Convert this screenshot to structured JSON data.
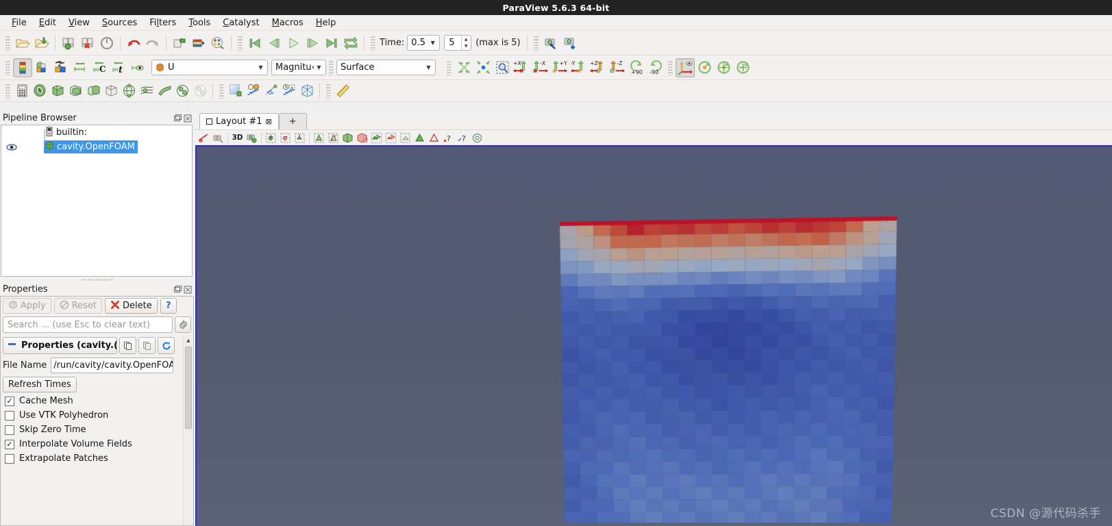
{
  "window": {
    "title": "ParaView 5.6.3 64-bit"
  },
  "menubar": {
    "items": [
      {
        "label": "File",
        "mnemonic": "F"
      },
      {
        "label": "Edit",
        "mnemonic": "E"
      },
      {
        "label": "View",
        "mnemonic": "V"
      },
      {
        "label": "Sources",
        "mnemonic": "S"
      },
      {
        "label": "Filters",
        "mnemonic": "l"
      },
      {
        "label": "Tools",
        "mnemonic": "T"
      },
      {
        "label": "Catalyst",
        "mnemonic": "C"
      },
      {
        "label": "Macros",
        "mnemonic": "M"
      },
      {
        "label": "Help",
        "mnemonic": "H"
      }
    ]
  },
  "toolbar_main": {
    "icons": [
      "open-file-icon",
      "open-recent-icon",
      "save-state-icon",
      "load-state-icon",
      "reset-session-icon",
      "undo-icon",
      "redo-icon",
      "connect-server-icon",
      "color-map-editor-icon",
      "edit-color-legend-icon"
    ],
    "time_label": "Time:",
    "time_value": "0.5",
    "frame_value": "5",
    "max_label": "(max is 5)",
    "vcr": [
      "first-frame-icon",
      "previous-frame-icon",
      "play-icon",
      "next-frame-icon",
      "last-frame-icon",
      "loop-icon"
    ],
    "camera_icons": [
      "save-screenshot-icon",
      "save-animation-icon"
    ]
  },
  "toolbar_repr": {
    "icons_left": [
      "color-legend-toggle-icon",
      "edit-color-map-icon",
      "rescale-to-data-range-icon",
      "rescale-to-custom-range-icon",
      "rescale-to-data-over-time-icon",
      "rescale-to-temporal-range-icon",
      "rescale-visible-range-icon"
    ],
    "array_combo": {
      "value": "U",
      "icon": "point-data-icon"
    },
    "component_combo": {
      "value": "Magnitu‹"
    },
    "representation_combo": {
      "value": "Surface"
    },
    "camera_icons": [
      "reset-camera-icon",
      "zoom-to-data-icon",
      "zoom-to-box-icon",
      "plus-x-icon",
      "minus-x-icon",
      "plus-y-icon",
      "minus-y-icon",
      "plus-z-icon",
      "minus-z-icon",
      "rotate-90-ccw-icon",
      "rotate-90-cw-icon",
      "show-center-axes-icon",
      "reset-center-icon",
      "pick-center-icon",
      "show-orientation-axes-icon"
    ],
    "axis_labels": {
      "px": "+X",
      "mx": "-X",
      "py": "+Y",
      "my": "-Y",
      "pz": "+Z",
      "mz": "-Z",
      "rp": "+90",
      "rm": "-90"
    }
  },
  "toolbar_filters": {
    "icons": [
      "calculator-icon",
      "contour-icon",
      "clip-icon",
      "slice-icon",
      "threshold-icon",
      "extract-subset-icon",
      "glyph-icon",
      "stream-tracer-icon",
      "warp-icon",
      "group-datasets-icon",
      "extract-level-icon",
      "last-used-filter-icon",
      "plot-over-line-icon",
      "plot-selection-icon",
      "plot-over-time-icon",
      "spreadsheet-icon",
      "ruler-icon"
    ]
  },
  "pipeline_browser": {
    "title": "Pipeline Browser",
    "header_buttons": [
      "undock-icon",
      "close-icon"
    ],
    "items": [
      {
        "label": "builtin:",
        "icon": "server-icon",
        "selected": false,
        "visible": false,
        "indent": 1
      },
      {
        "label": "cavity.OpenFOAM",
        "icon": "dataset-icon",
        "selected": true,
        "visible": true,
        "indent": 2
      }
    ]
  },
  "properties_panel": {
    "title": "Properties",
    "header_buttons": [
      "undock-icon",
      "close-icon"
    ],
    "buttons": [
      {
        "label": "Apply",
        "name": "apply-button",
        "enabled": false,
        "icon": "apply-icon"
      },
      {
        "label": "Reset",
        "name": "reset-button",
        "enabled": false,
        "icon": "reset-icon"
      },
      {
        "label": "Delete",
        "name": "delete-button",
        "enabled": true,
        "icon": "delete-icon"
      },
      {
        "label": "?",
        "name": "help-button",
        "enabled": true,
        "icon": "help-icon"
      }
    ],
    "search_placeholder": "Search ... (use Esc to clear text)",
    "gear_icon": "advanced-properties-icon",
    "section": {
      "label": "Properties (cavity.(",
      "buttons": [
        "copy-properties-icon",
        "paste-properties-icon",
        "restore-defaults-icon"
      ]
    },
    "file_name": {
      "label": "File Name",
      "value": "/run/cavity/cavity.OpenFOAI"
    },
    "refresh_button": "Refresh Times",
    "checkboxes": [
      {
        "label": "Cache Mesh",
        "checked": true
      },
      {
        "label": "Use VTK Polyhedron",
        "checked": false
      },
      {
        "label": "Skip Zero Time",
        "checked": false
      },
      {
        "label": "Interpolate Volume Fields",
        "checked": true
      },
      {
        "label": "Extrapolate Patches",
        "checked": false
      }
    ]
  },
  "layout": {
    "tabs": [
      {
        "label": "Layout #1",
        "active": true,
        "closable": true
      },
      {
        "label": "+",
        "active": false,
        "closable": false
      }
    ],
    "view_toolbar": {
      "label_3d": "3D",
      "icons": [
        "interact-mode-icon",
        "select-cells-through-icon",
        "camera-undo-icon",
        "select-cells-on-icon",
        "select-points-on-icon",
        "select-cells-through-2-icon",
        "select-points-polygon-icon",
        "select-cells-polygon-icon",
        "frustum-select-cells-icon",
        "frustum-select-points-icon",
        "select-blocks-icon",
        "interactive-select-cells-icon",
        "hover-cells-icon",
        "hover-points-icon",
        "query-cells-icon",
        "query-points-icon",
        "reset-selection-icon"
      ]
    }
  },
  "render_view": {
    "background_color": "#535a70",
    "border_color": "#2b2bd8",
    "watermark": "CSDN @源代码杀手",
    "description": "OpenFOAM cavity case surface colored by U magnitude; red moving lid at top, blue interior"
  },
  "colors": {
    "titlebar_bg": "#232323",
    "chrome_bg": "#f2f1f0",
    "selection_blue": "#3d96e8",
    "accent_red": "#c4121f",
    "viewport_bg": "#535a70"
  }
}
